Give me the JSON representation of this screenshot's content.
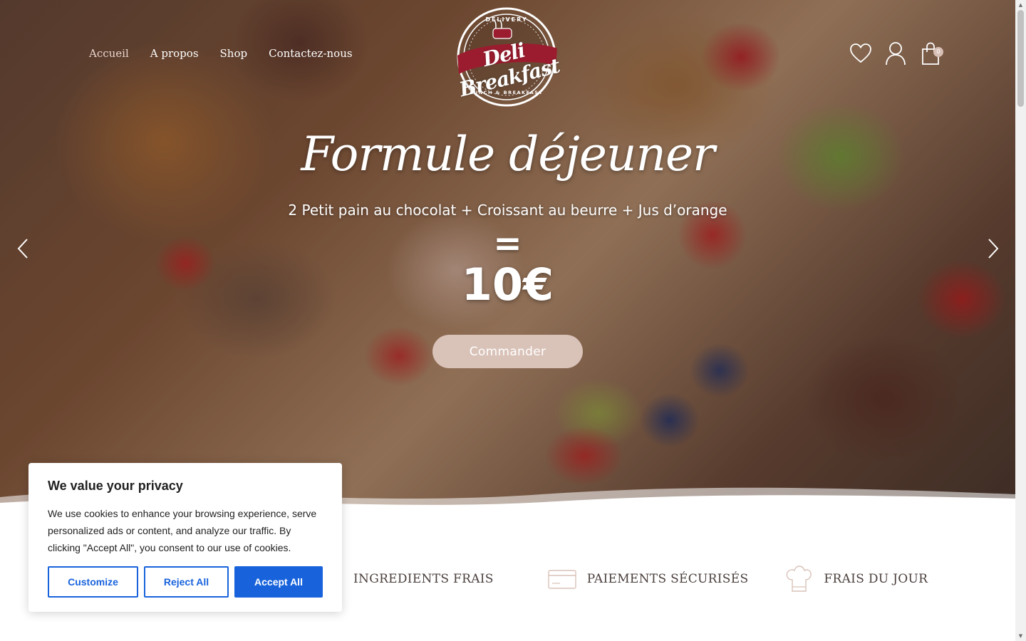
{
  "nav": {
    "items": [
      {
        "label": "Accueil",
        "active": true
      },
      {
        "label": "A propos",
        "active": false
      },
      {
        "label": "Shop",
        "active": false
      },
      {
        "label": "Contactez-nous",
        "active": false
      }
    ]
  },
  "logo": {
    "name": "Deli Breakfast",
    "top_text": "DELIVERY",
    "bottom_text": "LUNCH & BREAKFAST"
  },
  "header_icons": {
    "wishlist": "heart-icon",
    "account": "user-icon",
    "cart": "shopping-bag-icon",
    "cart_count": "0"
  },
  "hero": {
    "title": "Formule déjeuner",
    "subtitle": "2 Petit pain au chocolat + Croissant au beurre + Jus d’orange",
    "equals": "=",
    "price": "10€",
    "cta_label": "Commander",
    "cta_color": "#d9c2b8",
    "prev_icon": "chevron-left-icon",
    "next_icon": "chevron-right-icon"
  },
  "features": [
    {
      "label": "INGREDIENTS FRAIS",
      "icon": "leaf-icon"
    },
    {
      "label": "PAIEMENTS SÉCURISÉS",
      "icon": "credit-card-icon"
    },
    {
      "label": "FRAIS DU JOUR",
      "icon": "chef-hat-icon"
    }
  ],
  "cookie_banner": {
    "title": "We value your privacy",
    "text": "We use cookies to enhance your browsing experience, serve personalized ads or content, and analyze our traffic. By clicking \"Accept All\", you consent to our use of cookies.",
    "buttons": {
      "customize": "Customize",
      "reject": "Reject All",
      "accept": "Accept All"
    },
    "accent_color": "#1863dc"
  }
}
